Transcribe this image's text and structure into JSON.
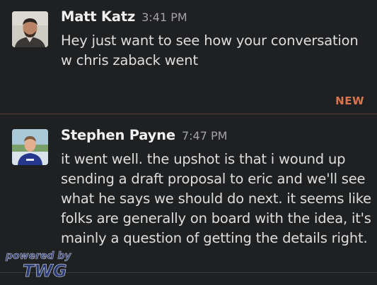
{
  "messages": [
    {
      "sender": "Matt Katz",
      "time": "3:41 PM",
      "text": "Hey just want to see how your conversation w chris zaback went"
    },
    {
      "sender": "Stephen Payne",
      "time": "7:47 PM",
      "text": "it went well. the upshot is that i wound up sending a draft proposal to eric and we'll see what he says we should do next. it seems like folks are generally on board with the idea, it's mainly a question of getting the details right."
    }
  ],
  "divider": {
    "label": "NEW",
    "color": "#d8744f"
  },
  "watermark": {
    "line1": "powered by",
    "line2": "TWG"
  }
}
